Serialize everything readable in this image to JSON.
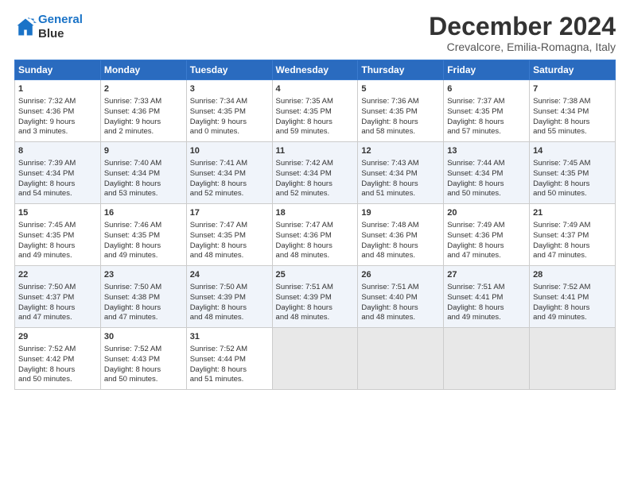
{
  "logo": {
    "line1": "General",
    "line2": "Blue"
  },
  "title": "December 2024",
  "location": "Crevalcore, Emilia-Romagna, Italy",
  "days_of_week": [
    "Sunday",
    "Monday",
    "Tuesday",
    "Wednesday",
    "Thursday",
    "Friday",
    "Saturday"
  ],
  "weeks": [
    [
      {
        "day": 1,
        "lines": [
          "Sunrise: 7:32 AM",
          "Sunset: 4:36 PM",
          "Daylight: 9 hours",
          "and 3 minutes."
        ]
      },
      {
        "day": 2,
        "lines": [
          "Sunrise: 7:33 AM",
          "Sunset: 4:36 PM",
          "Daylight: 9 hours",
          "and 2 minutes."
        ]
      },
      {
        "day": 3,
        "lines": [
          "Sunrise: 7:34 AM",
          "Sunset: 4:35 PM",
          "Daylight: 9 hours",
          "and 0 minutes."
        ]
      },
      {
        "day": 4,
        "lines": [
          "Sunrise: 7:35 AM",
          "Sunset: 4:35 PM",
          "Daylight: 8 hours",
          "and 59 minutes."
        ]
      },
      {
        "day": 5,
        "lines": [
          "Sunrise: 7:36 AM",
          "Sunset: 4:35 PM",
          "Daylight: 8 hours",
          "and 58 minutes."
        ]
      },
      {
        "day": 6,
        "lines": [
          "Sunrise: 7:37 AM",
          "Sunset: 4:35 PM",
          "Daylight: 8 hours",
          "and 57 minutes."
        ]
      },
      {
        "day": 7,
        "lines": [
          "Sunrise: 7:38 AM",
          "Sunset: 4:34 PM",
          "Daylight: 8 hours",
          "and 55 minutes."
        ]
      }
    ],
    [
      {
        "day": 8,
        "lines": [
          "Sunrise: 7:39 AM",
          "Sunset: 4:34 PM",
          "Daylight: 8 hours",
          "and 54 minutes."
        ]
      },
      {
        "day": 9,
        "lines": [
          "Sunrise: 7:40 AM",
          "Sunset: 4:34 PM",
          "Daylight: 8 hours",
          "and 53 minutes."
        ]
      },
      {
        "day": 10,
        "lines": [
          "Sunrise: 7:41 AM",
          "Sunset: 4:34 PM",
          "Daylight: 8 hours",
          "and 52 minutes."
        ]
      },
      {
        "day": 11,
        "lines": [
          "Sunrise: 7:42 AM",
          "Sunset: 4:34 PM",
          "Daylight: 8 hours",
          "and 52 minutes."
        ]
      },
      {
        "day": 12,
        "lines": [
          "Sunrise: 7:43 AM",
          "Sunset: 4:34 PM",
          "Daylight: 8 hours",
          "and 51 minutes."
        ]
      },
      {
        "day": 13,
        "lines": [
          "Sunrise: 7:44 AM",
          "Sunset: 4:34 PM",
          "Daylight: 8 hours",
          "and 50 minutes."
        ]
      },
      {
        "day": 14,
        "lines": [
          "Sunrise: 7:45 AM",
          "Sunset: 4:35 PM",
          "Daylight: 8 hours",
          "and 50 minutes."
        ]
      }
    ],
    [
      {
        "day": 15,
        "lines": [
          "Sunrise: 7:45 AM",
          "Sunset: 4:35 PM",
          "Daylight: 8 hours",
          "and 49 minutes."
        ]
      },
      {
        "day": 16,
        "lines": [
          "Sunrise: 7:46 AM",
          "Sunset: 4:35 PM",
          "Daylight: 8 hours",
          "and 49 minutes."
        ]
      },
      {
        "day": 17,
        "lines": [
          "Sunrise: 7:47 AM",
          "Sunset: 4:35 PM",
          "Daylight: 8 hours",
          "and 48 minutes."
        ]
      },
      {
        "day": 18,
        "lines": [
          "Sunrise: 7:47 AM",
          "Sunset: 4:36 PM",
          "Daylight: 8 hours",
          "and 48 minutes."
        ]
      },
      {
        "day": 19,
        "lines": [
          "Sunrise: 7:48 AM",
          "Sunset: 4:36 PM",
          "Daylight: 8 hours",
          "and 48 minutes."
        ]
      },
      {
        "day": 20,
        "lines": [
          "Sunrise: 7:49 AM",
          "Sunset: 4:36 PM",
          "Daylight: 8 hours",
          "and 47 minutes."
        ]
      },
      {
        "day": 21,
        "lines": [
          "Sunrise: 7:49 AM",
          "Sunset: 4:37 PM",
          "Daylight: 8 hours",
          "and 47 minutes."
        ]
      }
    ],
    [
      {
        "day": 22,
        "lines": [
          "Sunrise: 7:50 AM",
          "Sunset: 4:37 PM",
          "Daylight: 8 hours",
          "and 47 minutes."
        ]
      },
      {
        "day": 23,
        "lines": [
          "Sunrise: 7:50 AM",
          "Sunset: 4:38 PM",
          "Daylight: 8 hours",
          "and 47 minutes."
        ]
      },
      {
        "day": 24,
        "lines": [
          "Sunrise: 7:50 AM",
          "Sunset: 4:39 PM",
          "Daylight: 8 hours",
          "and 48 minutes."
        ]
      },
      {
        "day": 25,
        "lines": [
          "Sunrise: 7:51 AM",
          "Sunset: 4:39 PM",
          "Daylight: 8 hours",
          "and 48 minutes."
        ]
      },
      {
        "day": 26,
        "lines": [
          "Sunrise: 7:51 AM",
          "Sunset: 4:40 PM",
          "Daylight: 8 hours",
          "and 48 minutes."
        ]
      },
      {
        "day": 27,
        "lines": [
          "Sunrise: 7:51 AM",
          "Sunset: 4:41 PM",
          "Daylight: 8 hours",
          "and 49 minutes."
        ]
      },
      {
        "day": 28,
        "lines": [
          "Sunrise: 7:52 AM",
          "Sunset: 4:41 PM",
          "Daylight: 8 hours",
          "and 49 minutes."
        ]
      }
    ],
    [
      {
        "day": 29,
        "lines": [
          "Sunrise: 7:52 AM",
          "Sunset: 4:42 PM",
          "Daylight: 8 hours",
          "and 50 minutes."
        ]
      },
      {
        "day": 30,
        "lines": [
          "Sunrise: 7:52 AM",
          "Sunset: 4:43 PM",
          "Daylight: 8 hours",
          "and 50 minutes."
        ]
      },
      {
        "day": 31,
        "lines": [
          "Sunrise: 7:52 AM",
          "Sunset: 4:44 PM",
          "Daylight: 8 hours",
          "and 51 minutes."
        ]
      },
      null,
      null,
      null,
      null
    ]
  ]
}
